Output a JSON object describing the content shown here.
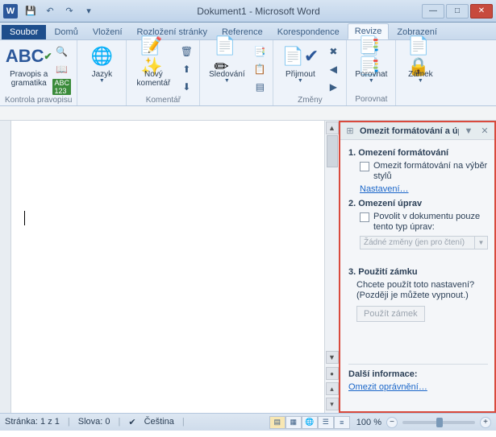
{
  "titlebar": {
    "app_icon_letter": "W",
    "title": "Dokument1 - Microsoft Word"
  },
  "qat": {
    "save": "💾",
    "undo": "↶",
    "redo": "↷"
  },
  "tabs": {
    "file": "Soubor",
    "home": "Domů",
    "insert": "Vložení",
    "layout": "Rozložení stránky",
    "references": "Reference",
    "mail": "Korespondence",
    "review": "Revize",
    "view": "Zobrazení"
  },
  "ribbon": {
    "proofing": {
      "spelling_label": "Pravopis a\ngramatika",
      "group_label": "Kontrola pravopisu"
    },
    "language": {
      "label": "Jazyk"
    },
    "comments": {
      "new_label": "Nový\nkomentář",
      "group_label": "Komentář"
    },
    "tracking": {
      "track_label": "Sledování"
    },
    "changes": {
      "accept_label": "Přijmout",
      "group_label": "Změny"
    },
    "compare": {
      "label": "Porovnat",
      "group_label": "Porovnat"
    },
    "protect": {
      "lock_label": "Zámek"
    }
  },
  "task_pane": {
    "title": "Omezit formátování a úpravy",
    "s1_title": "1. Omezení formátování",
    "s1_chk": "Omezit formátování na výběr stylů",
    "s1_link": "Nastavení…",
    "s2_title": "2. Omezení úprav",
    "s2_chk": "Povolit v dokumentu pouze tento typ úprav:",
    "s2_dd": "Žádné změny (jen pro čtení)",
    "s3_title": "3. Použití zámku",
    "s3_text": "Chcete použít toto nastavení? (Později je můžete vypnout.)",
    "s3_btn": "Použít zámek",
    "more_title": "Další informace:",
    "more_link": "Omezit oprávnění…"
  },
  "statusbar": {
    "page": "Stránka: 1 z 1",
    "words": "Slova: 0",
    "lang": "Čeština",
    "zoom_pct": "100 %"
  }
}
